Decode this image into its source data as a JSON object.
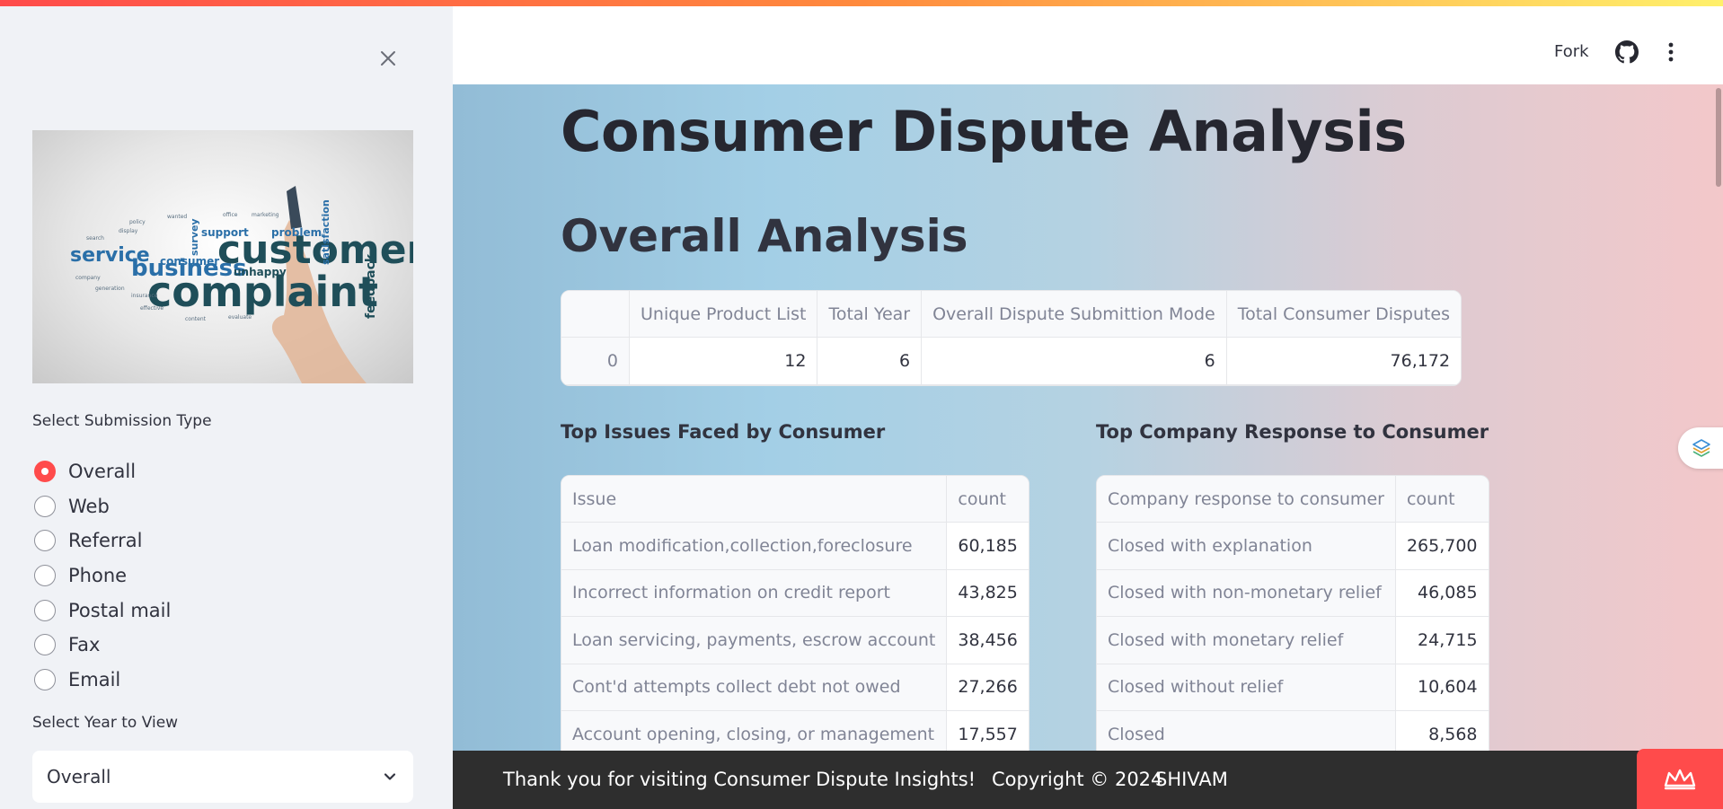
{
  "header": {
    "fork_label": "Fork",
    "github_icon": "github-icon",
    "menu_icon": "more-vertical-icon"
  },
  "sidebar": {
    "close_icon": "close-icon",
    "image": {
      "words": [
        "customer",
        "complaint",
        "business",
        "service",
        "consumer",
        "feedback",
        "satisfaction",
        "support",
        "problem",
        "unhappy",
        "survey"
      ]
    },
    "submission_label": "Select Submission Type",
    "submission_options": [
      "Overall",
      "Web",
      "Referral",
      "Phone",
      "Postal mail",
      "Fax",
      "Email"
    ],
    "submission_selected": "Overall",
    "year_label": "Select Year to View",
    "year_selected": "Overall",
    "year_chevron_icon": "chevron-down-icon"
  },
  "main": {
    "title": "Consumer Dispute Analysis",
    "subtitle": "Overall Analysis",
    "summary_table": {
      "headers": [
        "",
        "Unique Product List",
        "Total Year",
        "Overall Dispute Submittion Mode",
        "Total Consumer Disputes"
      ],
      "rows": [
        [
          "0",
          "12",
          "6",
          "6",
          "76,172"
        ]
      ]
    },
    "issues_heading": "Top Issues Faced by Consumer",
    "issues_table": {
      "headers": [
        "Issue",
        "count"
      ],
      "rows": [
        [
          "Loan modification,collection,foreclosure",
          "60,185"
        ],
        [
          "Incorrect information on credit report",
          "43,825"
        ],
        [
          "Loan servicing, payments, escrow account",
          "38,456"
        ],
        [
          "Cont'd attempts collect debt not owed",
          "27,266"
        ],
        [
          "Account opening, closing, or management",
          "17,557"
        ]
      ]
    },
    "response_heading": "Top Company Response to Consumer",
    "response_table": {
      "headers": [
        "Company response to consumer",
        "count"
      ],
      "rows": [
        [
          "Closed with explanation",
          "265,700"
        ],
        [
          "Closed with non-monetary relief",
          "46,085"
        ],
        [
          "Closed with monetary relief",
          "24,715"
        ],
        [
          "Closed without relief",
          "10,604"
        ],
        [
          "Closed",
          "8,568"
        ]
      ]
    }
  },
  "footer": {
    "thanks": "Thank you for visiting Consumer Dispute Insights!",
    "copyright": "Copyright © 2024",
    "author": "SHIVAM",
    "deploy_icon": "streamlit-crown-icon",
    "widget_icon": "layers-icon"
  },
  "colors": {
    "accent": "#ff4b4b",
    "footer_bg": "#2e2e2e",
    "sidebar_bg": "#f0f2f6",
    "text": "#31333F"
  }
}
